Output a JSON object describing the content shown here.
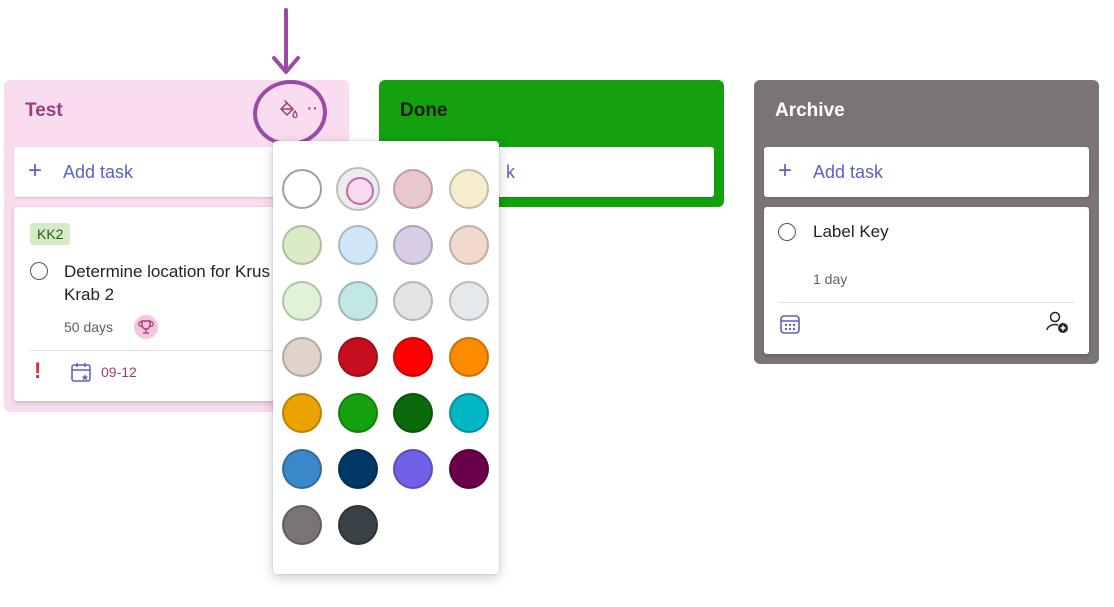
{
  "columns": {
    "test": {
      "title": "Test",
      "color": "#f9dcef",
      "add_task_label": "Add task",
      "card": {
        "label_badge": "KK2",
        "title_line1": "Determine location for Krus",
        "title_line2": "Krab 2",
        "duration": "50 days",
        "due_date": "09-12"
      }
    },
    "done": {
      "title": "Done",
      "color": "#13a10e",
      "add_task_label_partial": "k"
    },
    "archive": {
      "title": "Archive",
      "color": "#7a7574",
      "add_task_label": "Add task",
      "card": {
        "title": "Label Key",
        "duration": "1 day"
      }
    }
  },
  "color_picker": {
    "selected": "#f9dcef",
    "swatches": [
      "#ffffff",
      "#f9dcef",
      "#e9c7cd",
      "#f5edce",
      "#dbebc7",
      "#d0e7f8",
      "#d8cce7",
      "#f1d9cc",
      "#e0f2d7",
      "#c2e7e7",
      "#e3e3e3",
      "#e6e9ec",
      "#e0d3cb",
      "#c50f1f",
      "#ff0000",
      "#ff8c00",
      "#eaa300",
      "#13a10e",
      "#0b6a0b",
      "#00b7c3",
      "#3a87c9",
      "#003966",
      "#7160e8",
      "#6b004a",
      "#7a7574",
      "#394146"
    ]
  },
  "icons": {
    "bucket": "paint-bucket-icon",
    "more": "more-options-icon",
    "add": "plus-icon",
    "radio": "circle-checkbox-icon",
    "trophy": "trophy-icon",
    "priority": "exclamation-icon",
    "calendar": "calendar-icon",
    "assign": "assign-person-icon"
  },
  "annotation_color": "#9b4ba6"
}
